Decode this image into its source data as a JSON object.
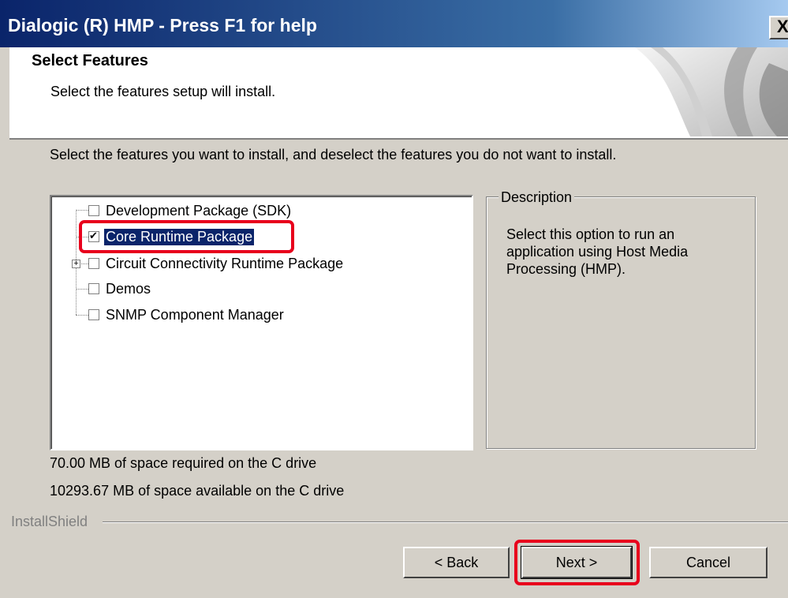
{
  "window": {
    "title": "Dialogic (R) HMP - Press F1 for help",
    "close_label": "X"
  },
  "header": {
    "title": "Select Features",
    "subtitle": "Select the features setup will install."
  },
  "instructions": "Select the features you want to install, and deselect the features you do not want to install.",
  "features": [
    {
      "label": "Development Package (SDK)",
      "checked": false,
      "expandable": false
    },
    {
      "label": "Core Runtime Package",
      "checked": true,
      "expandable": false,
      "selected": true
    },
    {
      "label": "Circuit Connectivity Runtime Package",
      "checked": false,
      "expandable": true
    },
    {
      "label": "Demos",
      "checked": false,
      "expandable": false
    },
    {
      "label": "SNMP Component Manager",
      "checked": false,
      "expandable": false
    }
  ],
  "description": {
    "title": "Description",
    "text": "Select this option to run an application using Host Media Processing (HMP)."
  },
  "space": {
    "required": "70.00 MB of space required on the C drive",
    "available": "10293.67 MB of space available on the C drive"
  },
  "brand": "InstallShield",
  "buttons": {
    "back": "< Back",
    "next": "Next >",
    "cancel": "Cancel"
  },
  "colors": {
    "highlight": "#e8001c",
    "selection": "#0a246a",
    "dialog_bg": "#d4d0c8"
  }
}
